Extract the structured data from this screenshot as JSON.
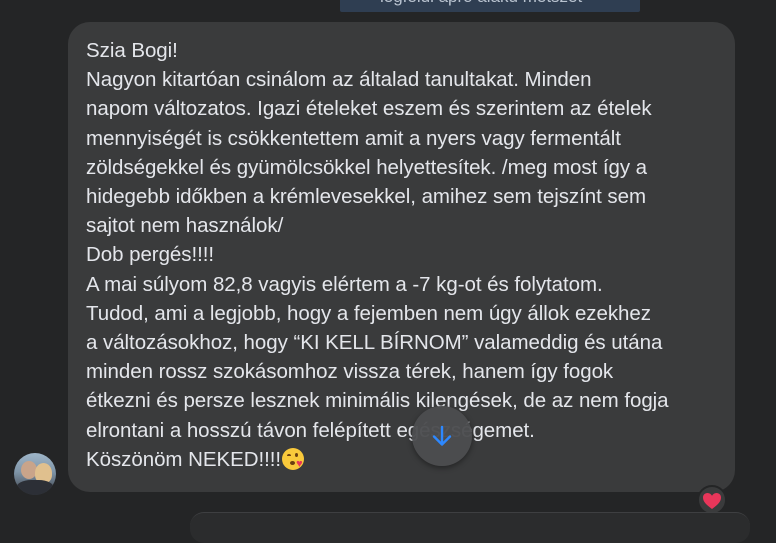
{
  "previous_message": {
    "text": "legfelül apró alakú metszet"
  },
  "message": {
    "lines": [
      "Szia Bogi!",
      "Nagyon kitartóan csinálom az általad tanultakat. Minden",
      "napom változatos. Igazi ételeket eszem és szerintem az ételek",
      "mennyiségét is csökkentettem amit a nyers vagy fermentált",
      "zöldségekkel és gyümölcsökkel helyettesítek. /meg most így a",
      "hidegebb időkben a krémlevesekkel, amihez sem tejszínt sem",
      "sajtot nem használok/",
      "Dob pergés!!!!",
      "A mai súlyom 82,8 vagyis elértem a -7 kg-ot és folytatom.",
      "Tudod, ami a legjobb, hogy a fejemben nem úgy állok ezekhez",
      "a változásokhoz, hogy “KI KELL BÍRNOM” valameddig és utána",
      "minden rossz szokásomhoz vissza térek, hanem így fogok",
      "étkezni és persze lesznek minimális kilengések, de az nem fogja",
      "elrontani a hosszú távon felépített egészségemet.",
      "Köszönöm NEKED!!!!"
    ],
    "closing_emoji": "face-blowing-a-kiss-emoji"
  },
  "reaction": {
    "icon": "heart-icon",
    "color": "#e8365a"
  },
  "scroll_button": {
    "icon": "arrow-down-icon",
    "color": "#2d88ff"
  },
  "colors": {
    "background": "#242526",
    "bubble": "#3a3b3c",
    "text": "#e4e6eb"
  }
}
